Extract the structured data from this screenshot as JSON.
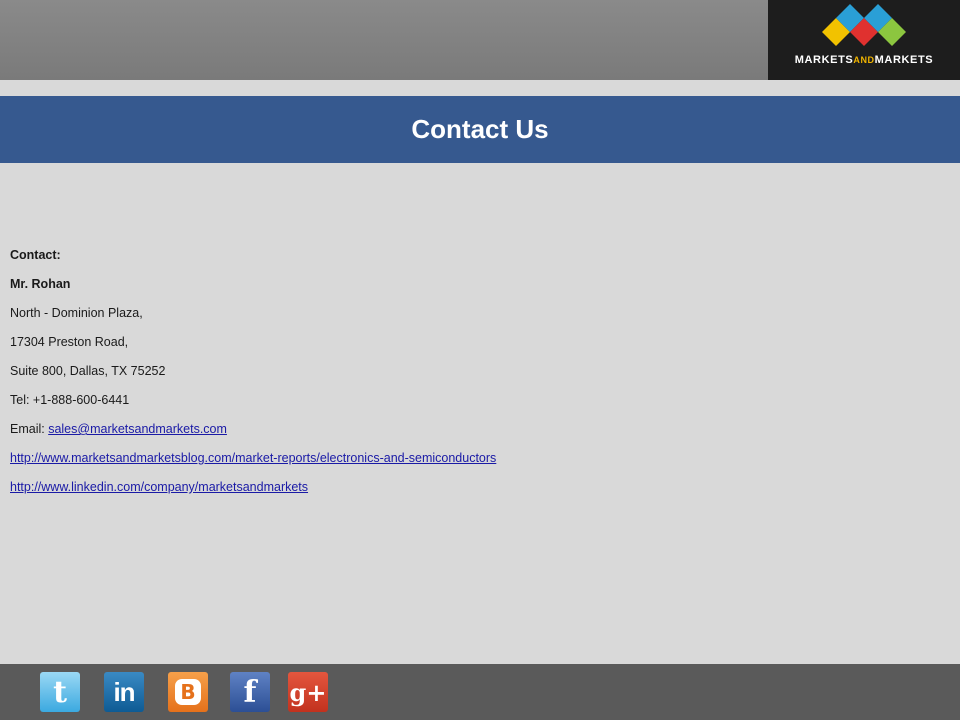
{
  "logo": {
    "text_markets": "MARKETS",
    "text_and": "AND",
    "text_markets2": "MARKETS",
    "colors": [
      "#f2c200",
      "#2a9fd6",
      "#e0312f",
      "#8cc63f"
    ]
  },
  "header": {
    "title": "Contact Us"
  },
  "contact": {
    "label": "Contact:",
    "name": "Mr. Rohan",
    "address_line1": "North - Dominion Plaza,",
    "address_line2": "17304 Preston Road,",
    "address_line3": "Suite 800, Dallas, TX 75252",
    "tel": "Tel: +1-888-600-6441",
    "email_label": "Email: ",
    "email": "sales@marketsandmarkets.com",
    "blog_url": "http://www.marketsandmarketsblog.com/market-reports/electronics-and-semiconductors",
    "linkedin_url": "http://www.linkedin.com/company/marketsandmarkets"
  },
  "social": {
    "icons": [
      "twitter-icon",
      "linkedin-icon",
      "blogger-icon",
      "facebook-icon",
      "google-plus-icon"
    ],
    "twitter_glyph": "t",
    "linkedin_glyph": "in",
    "blogger_glyph": "B",
    "facebook_glyph": "f",
    "google_glyph": "g+"
  },
  "colors": {
    "title_band": "#36598f",
    "background": "#d9d9d9",
    "footer": "#5a5a5a",
    "link": "#1a1aa6"
  }
}
